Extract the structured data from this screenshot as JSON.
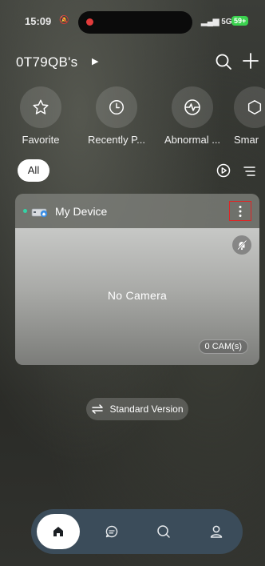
{
  "status_bar": {
    "time": "15:09",
    "signal": "5G",
    "battery": "59+"
  },
  "header": {
    "title": "0T79QB's"
  },
  "shortcuts": [
    {
      "label": "Favorite",
      "icon": "star-icon"
    },
    {
      "label": "Recently P...",
      "icon": "clock-icon"
    },
    {
      "label": "Abnormal ...",
      "icon": "pulse-icon"
    },
    {
      "label": "Smar",
      "icon": "cube-icon"
    }
  ],
  "filter": {
    "all_label": "All"
  },
  "device_card": {
    "name": "My Device",
    "empty_text": "No Camera",
    "cam_count": "0 CAM(s)"
  },
  "version_toggle": {
    "label": "Standard Version"
  },
  "tabbar": {
    "tabs": [
      {
        "icon": "home-icon",
        "active": true
      },
      {
        "icon": "message-icon",
        "active": false
      },
      {
        "icon": "discover-icon",
        "active": false
      },
      {
        "icon": "profile-icon",
        "active": false
      }
    ]
  },
  "colors": {
    "accent_online": "#34d3a6",
    "tabbar_bg": "#3b4c5a",
    "highlight_border": "#e02424"
  }
}
